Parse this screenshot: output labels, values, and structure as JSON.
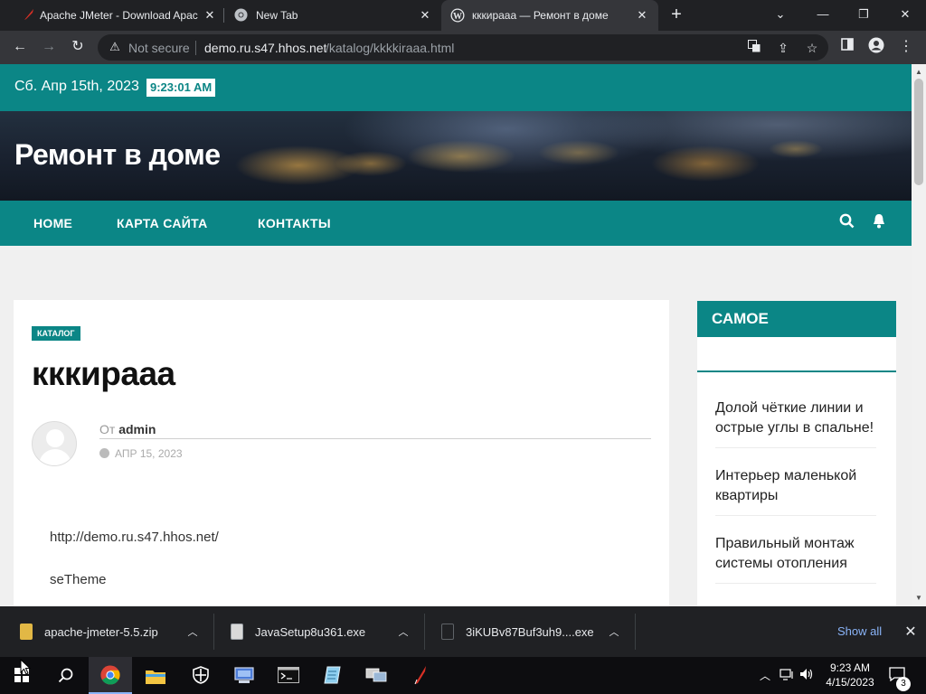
{
  "browser": {
    "tabs": [
      {
        "title": "Apache JMeter - Download Apac",
        "icon": "jmeter-feather-icon",
        "active": false
      },
      {
        "title": "New Tab",
        "icon": "chrome-icon",
        "active": false
      },
      {
        "title": "кккираaa — Ремонт в доме",
        "icon": "wordpress-icon",
        "active": true
      }
    ],
    "new_tab_label": "+",
    "window_controls": {
      "menu": "⌄",
      "minimize": "—",
      "restore": "❐",
      "close": "✕"
    },
    "nav": {
      "back": "←",
      "forward": "→",
      "reload": "↻"
    },
    "omnibox": {
      "security_label": "Not secure",
      "url_host": "demo.ru.s47.hhos.net",
      "url_path": "/katalog/kkkkiraaa.html"
    }
  },
  "site": {
    "date": "Сб. Апр 15th, 2023",
    "time": "9:23:01 AM",
    "title": "Ремонт в доме",
    "nav": {
      "home": "HOME",
      "sitemap": "КАРТА САЙТА",
      "contacts": "КОНТАКТЫ"
    },
    "post": {
      "category": "КАТАЛОГ",
      "title": "кккираaa",
      "author_prefix": "От",
      "author": "admin",
      "date": "АПР 15, 2023",
      "lines": [
        "http://demo.ru.s47.hhos.net/",
        "seTheme"
      ]
    },
    "sidebar": {
      "heading": "САМОЕ",
      "items": [
        "Долой чёткие линии и острые углы в спальне!",
        "Интерьер маленькой квартиры",
        "Правильный монтаж системы отопления"
      ]
    }
  },
  "downloads": {
    "items": [
      {
        "name": "apache-jmeter-5.5.zip",
        "icon": "zip-file-icon",
        "color": "#e2b845"
      },
      {
        "name": "JavaSetup8u361.exe",
        "icon": "java-installer-icon",
        "color": "#d9d9d9"
      },
      {
        "name": "3iKUBv87Buf3uh9....exe",
        "icon": "exe-file-icon",
        "color": "#202124"
      }
    ],
    "show_all": "Show all"
  },
  "taskbar": {
    "clock_time": "9:23 AM",
    "clock_date": "4/15/2023",
    "notifications": "3",
    "apps": [
      "start-icon",
      "search-icon",
      "chrome-icon",
      "file-explorer-icon",
      "security-shield-icon",
      "network-app-icon",
      "terminal-icon",
      "notepad-icon",
      "remote-desktop-icon",
      "jmeter-icon"
    ]
  },
  "colors": {
    "teal": "#0b8686",
    "chrome_dark": "#202124",
    "chrome_mid": "#35363a"
  }
}
